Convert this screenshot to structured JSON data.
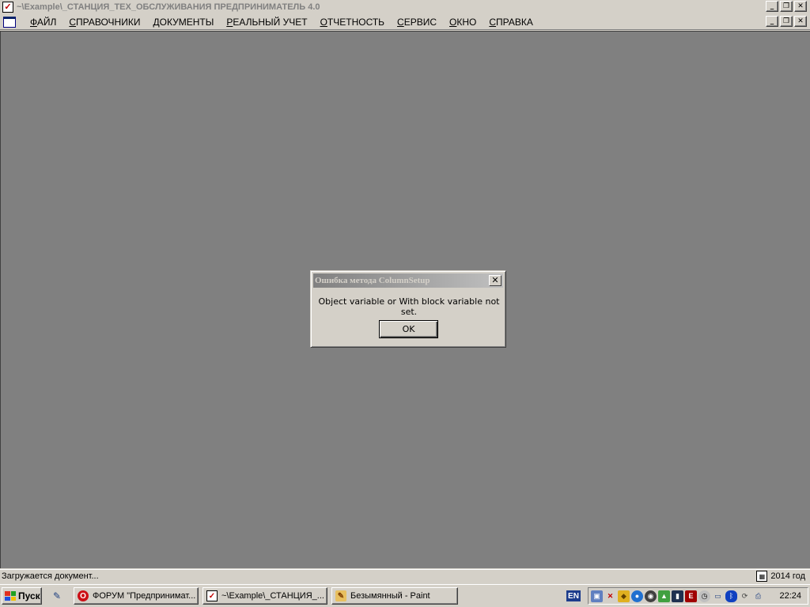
{
  "window": {
    "title": "~\\Example\\_СТАНЦИЯ_ТЕХ_ОБСЛУЖИВАНИЯ  ПРЕДПРИНИМАТЕЛЬ 4.0",
    "minimize_glyph": "_",
    "restore_glyph": "❐",
    "close_glyph": "✕"
  },
  "menu": {
    "items": [
      {
        "accel": "Ф",
        "rest": "АЙЛ"
      },
      {
        "accel": "С",
        "rest": "ПРАВОЧНИКИ"
      },
      {
        "accel": "Д",
        "rest": "ОКУМЕНТЫ"
      },
      {
        "accel": "Р",
        "rest": "ЕАЛЬНЫЙ УЧЕТ"
      },
      {
        "accel": "О",
        "rest": "ТЧЕТНОСТЬ"
      },
      {
        "accel": "С",
        "rest": "ЕРВИС"
      },
      {
        "accel": "О",
        "rest": "КНО"
      },
      {
        "accel": "С",
        "rest": "ПРАВКА"
      }
    ]
  },
  "dialog": {
    "title": "Ошибка метода ColumnSetup",
    "message": "Object variable or With block variable not set.",
    "ok_label": "OK",
    "close_glyph": "✕"
  },
  "statusbar": {
    "left_text": "Загружается документ...",
    "year_text": "2014 год"
  },
  "taskbar": {
    "start_label": "Пуск",
    "tasks": [
      {
        "icon": "opera-icon",
        "glyph": "O",
        "label": "ФОРУМ \"Предпринимат..."
      },
      {
        "icon": "checkbox-app-icon",
        "glyph": "✓",
        "label": "~\\Example\\_СТАНЦИЯ_..."
      },
      {
        "icon": "paint-icon",
        "glyph": "✎",
        "label": "Безымянный - Paint"
      }
    ],
    "language": "EN",
    "clock": "22:24"
  },
  "colors": {
    "workspace": "#808080",
    "face": "#d4d0c8",
    "inactive_title_start": "#808080",
    "inactive_title_end": "#c0c0c0"
  }
}
